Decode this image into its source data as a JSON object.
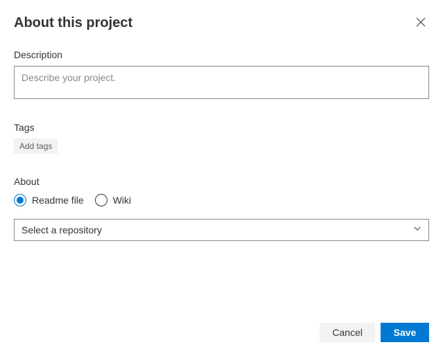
{
  "header": {
    "title": "About this project"
  },
  "description": {
    "label": "Description",
    "placeholder": "Describe your project.",
    "value": ""
  },
  "tags": {
    "label": "Tags",
    "add_button": "Add tags"
  },
  "about": {
    "label": "About",
    "options": {
      "readme": "Readme file",
      "wiki": "Wiki"
    },
    "selected": "readme",
    "repository_select": "Select a repository"
  },
  "footer": {
    "cancel": "Cancel",
    "save": "Save"
  }
}
